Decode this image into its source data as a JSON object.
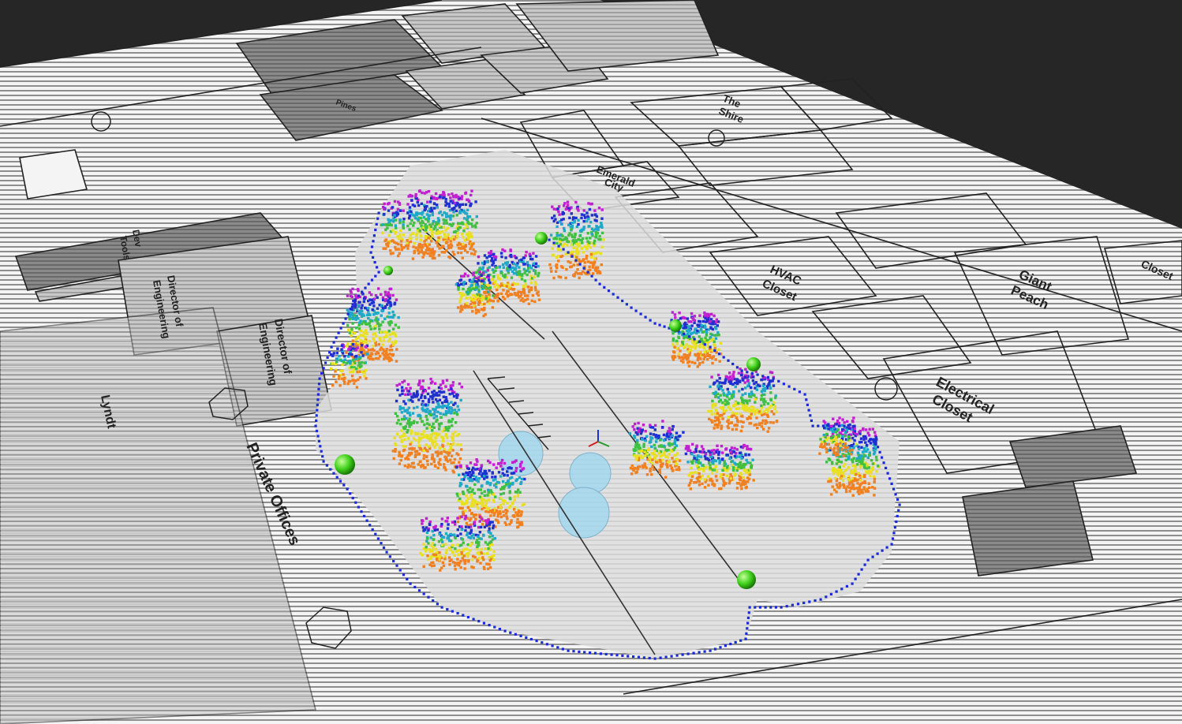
{
  "viewer": {
    "background_color": "#262626",
    "floor_color": "#f2f2f2",
    "grid_line_color": "#2a2a2a"
  },
  "floorplan": {
    "room_labels": {
      "pines": "Pines",
      "emerald_city_line1": "Emerald",
      "emerald_city_line2": "City",
      "the_shire_line1": "The",
      "the_shire_line2": "Shire",
      "hvac_closet_line1": "HVAC",
      "hvac_closet_line2": "Closet",
      "giant_peach_line1": "Giant",
      "giant_peach_line2": "Peach",
      "electrical_closet_line1": "Electrical",
      "electrical_closet_line2": "Closet",
      "director_line1": "Director of",
      "director_line2": "Engineering",
      "director2_line1": "Director of",
      "director2_line2": "Engineering",
      "lyndt": "Lyndt",
      "private_offices": "Private Offices",
      "dev_tools_line1": "Dev",
      "dev_tools_line2": "Tools",
      "closet": "Closet"
    }
  },
  "pointcloud": {
    "color_low": "#e0201a",
    "color_mid": "#f0e020",
    "color_high": "#2030d0",
    "color_top": "#c020d0",
    "boundary_color": "#1a2ad6",
    "marker_color": "#3ecf1a",
    "costmap_color": "#9fd8ee"
  }
}
